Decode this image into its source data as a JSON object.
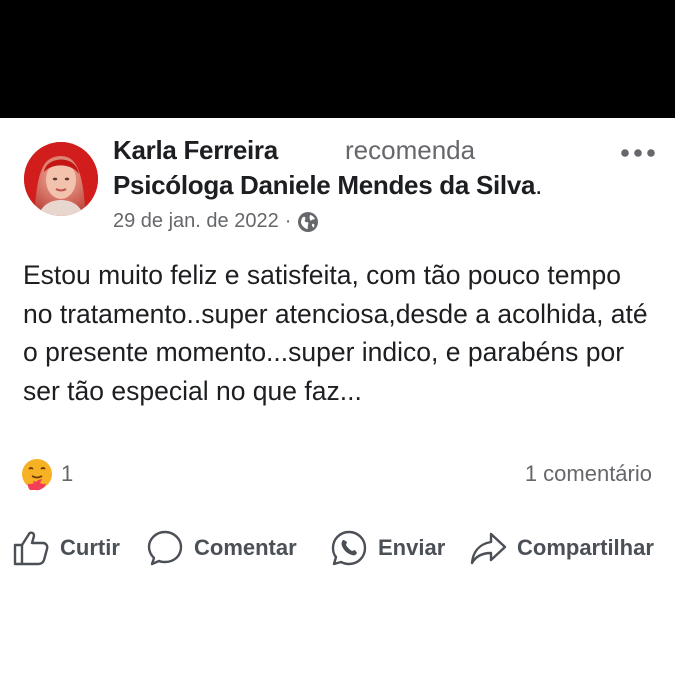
{
  "post": {
    "author": "Karla Ferreira",
    "action": "recomenda",
    "page": "Psicóloga Daniele Mendes da Silva",
    "page_suffix": ".",
    "date": "29 de jan. de 2022",
    "separator": "·",
    "privacy_icon": "globe-icon",
    "more_icon": "more-options-icon",
    "text": "Estou muito feliz e satisfeita, com tão pouco tempo no tratamento..super atenciosa,desde a acolhida, até o presente momento...super indico, e parabéns por ser tão especial no que faz...",
    "reaction_icon": "care-reaction-icon",
    "reaction_count": "1",
    "comment_count": "1 comentário"
  },
  "actions": {
    "like": "Curtir",
    "comment": "Comentar",
    "send": "Enviar",
    "share": "Compartilhar"
  },
  "colors": {
    "text": "#1c1e21",
    "secondary": "#65676b",
    "action_text": "#4b4f56",
    "header_bg": "#000000"
  }
}
